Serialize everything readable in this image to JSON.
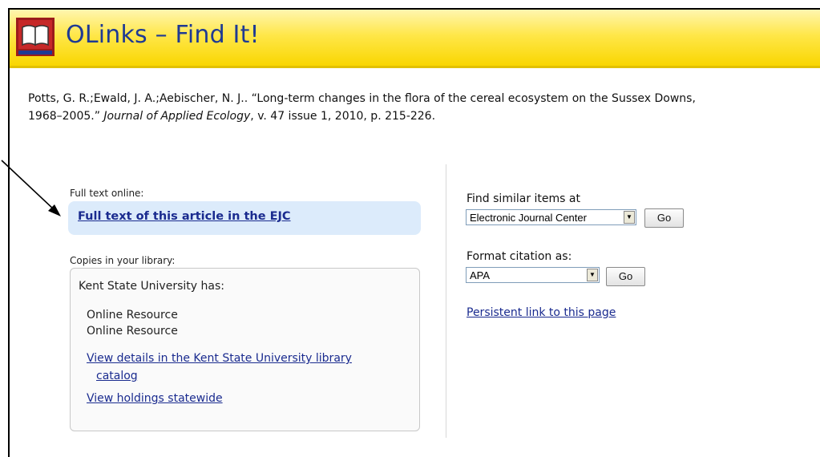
{
  "header": {
    "title": "OLinks – Find It!",
    "logo_icon": "book-icon"
  },
  "citation": {
    "authors_and_title": "Potts, G. R.;Ewald, J. A.;Aebischer, N. J.. “Long-term changes in the flora of the cereal ecosystem on the Sussex Downs,",
    "years": "1968–2005.”",
    "journal": "Journal of Applied Ecology",
    "details": ", v. 47 issue 1, 2010, p. 215-226."
  },
  "fulltext": {
    "label": "Full text online:",
    "link": "Full text of this article in the EJC"
  },
  "copies": {
    "label": "Copies in your library:",
    "holder": "Kent State University has:",
    "resources": [
      "Online Resource",
      "Online Resource"
    ],
    "details_link_line1": "View details in the Kent State University library",
    "details_link_line2": "catalog",
    "holdings_link": "View holdings statewide"
  },
  "similar": {
    "label": "Find similar items at",
    "selected": "Electronic Journal Center",
    "go": "Go"
  },
  "format": {
    "label": "Format citation as:",
    "selected": "APA",
    "go": "Go"
  },
  "persistent_link": "Persistent link to this page",
  "colors": {
    "header_yellow": "#ffe74a",
    "link_blue": "#1a2b8f",
    "highlight_blue": "#dcebfb"
  }
}
